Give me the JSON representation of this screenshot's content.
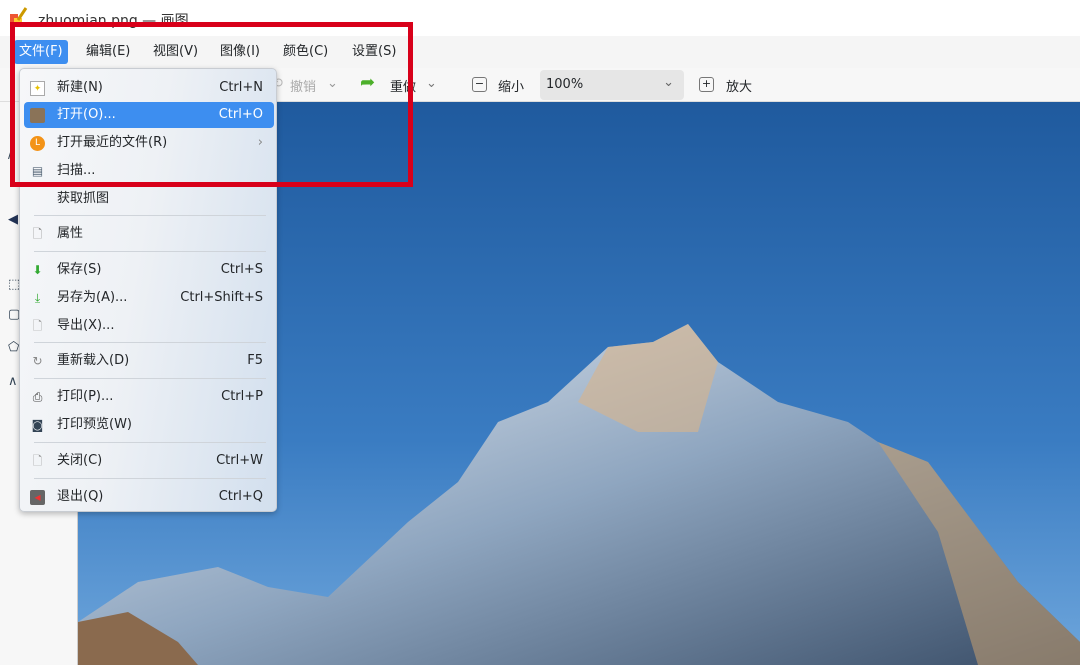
{
  "window": {
    "title": "zhuomian.png — 画图"
  },
  "menubar": [
    {
      "label": "文件(F)",
      "active": true
    },
    {
      "label": "编辑(E)"
    },
    {
      "label": "视图(V)"
    },
    {
      "label": "图像(I)"
    },
    {
      "label": "颜色(C)"
    },
    {
      "label": "设置(S)"
    }
  ],
  "toolbar": {
    "undo": "撤销",
    "redo": "重做",
    "zoom_out": "缩小",
    "zoom_value": "100%",
    "zoom_in": "放大"
  },
  "file_menu": [
    {
      "label": "新建(N)",
      "shortcut": "Ctrl+N",
      "icon": "new-file-icon"
    },
    {
      "label": "打开(O)...",
      "shortcut": "Ctrl+O",
      "icon": "folder-open-icon",
      "selected": true
    },
    {
      "label": "打开最近的文件(R)",
      "shortcut": "",
      "icon": "recent-clock-icon",
      "submenu": true
    },
    {
      "label": "扫描...",
      "shortcut": "",
      "icon": "scanner-icon"
    },
    {
      "label": "获取抓图",
      "shortcut": ""
    },
    {
      "label": "属性",
      "shortcut": "",
      "icon": "properties-icon"
    },
    {
      "label": "保存(S)",
      "shortcut": "Ctrl+S",
      "icon": "save-icon"
    },
    {
      "label": "另存为(A)...",
      "shortcut": "Ctrl+Shift+S",
      "icon": "save-as-icon"
    },
    {
      "label": "导出(X)...",
      "shortcut": "",
      "icon": "export-icon"
    },
    {
      "label": "重新载入(D)",
      "shortcut": "F5",
      "icon": "reload-icon"
    },
    {
      "label": "打印(P)...",
      "shortcut": "Ctrl+P",
      "icon": "print-icon"
    },
    {
      "label": "打印预览(W)",
      "shortcut": "",
      "icon": "print-preview-icon"
    },
    {
      "label": "关闭(C)",
      "shortcut": "Ctrl+W",
      "icon": "close-doc-icon"
    },
    {
      "label": "退出(Q)",
      "shortcut": "Ctrl+Q",
      "icon": "quit-icon"
    }
  ],
  "submenu_arrow": "›",
  "colors": {
    "accent": "#3d8ef0",
    "highlight_box": "#d8001a",
    "sky": "#2a64a8"
  }
}
